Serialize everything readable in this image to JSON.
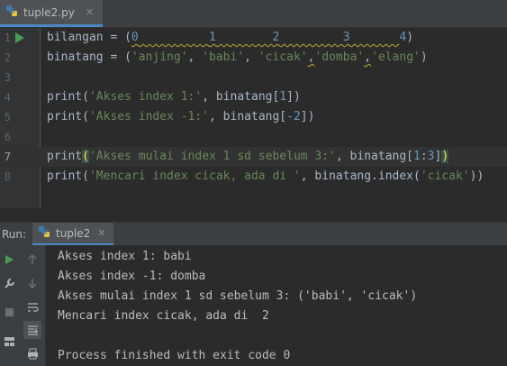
{
  "editor_tab": {
    "filename": "tuple2.py",
    "close_glyph": "✕"
  },
  "editor": {
    "line_numbers": [
      "1",
      "2",
      "3",
      "4",
      "5",
      "6",
      "7",
      "8"
    ],
    "lines": {
      "l1": {
        "a": "bilangan = (",
        "n0": "0",
        "n1": "1",
        "n2": "2",
        "n3": "3",
        "n4": "4",
        "end": ")"
      },
      "l2": {
        "a": "binatang = (",
        "s1": "'anjing'",
        "c1": ", ",
        "s2": "'babi'",
        "c2": ", ",
        "s3": "'cicak'",
        "c3": ",",
        "s4": "'domba'",
        "c4": ",",
        "s5": "'elang'",
        "end": ")"
      },
      "l4": {
        "a": "print(",
        "s": "'Akses index 1:'",
        "b": ", binatang[",
        "n": "1",
        "end": "])"
      },
      "l5": {
        "a": "print(",
        "s": "'Akses index -1:'",
        "b": ", binatang[",
        "n": "-2",
        "end": "])"
      },
      "l7": {
        "a": "print",
        "open": "(",
        "s": "'Akses mulai index 1 sd sebelum 3:'",
        "b": ", binatang[",
        "n1": "1",
        "colon": ":",
        "n2": "3",
        "close1": "]",
        "close": ")"
      },
      "l8": {
        "a": "print(",
        "s": "'Mencari index cicak, ada di '",
        "b": ", binatang.index(",
        "s2": "'cicak'",
        "end": "))"
      }
    }
  },
  "run_panel": {
    "label": "Run:",
    "tab_name": "tuple2",
    "close_glyph": "✕",
    "output": [
      "Akses index 1: babi",
      "Akses index -1: domba",
      "Akses mulai index 1 sd sebelum 3: ('babi', 'cicak')",
      "Mencari index cicak, ada di  2",
      "",
      "Process finished with exit code 0"
    ]
  },
  "colors": {
    "keyword_string": "#6a8759",
    "number": "#6897bb",
    "run_green": "#499c54",
    "accent": "#4a88c7"
  }
}
